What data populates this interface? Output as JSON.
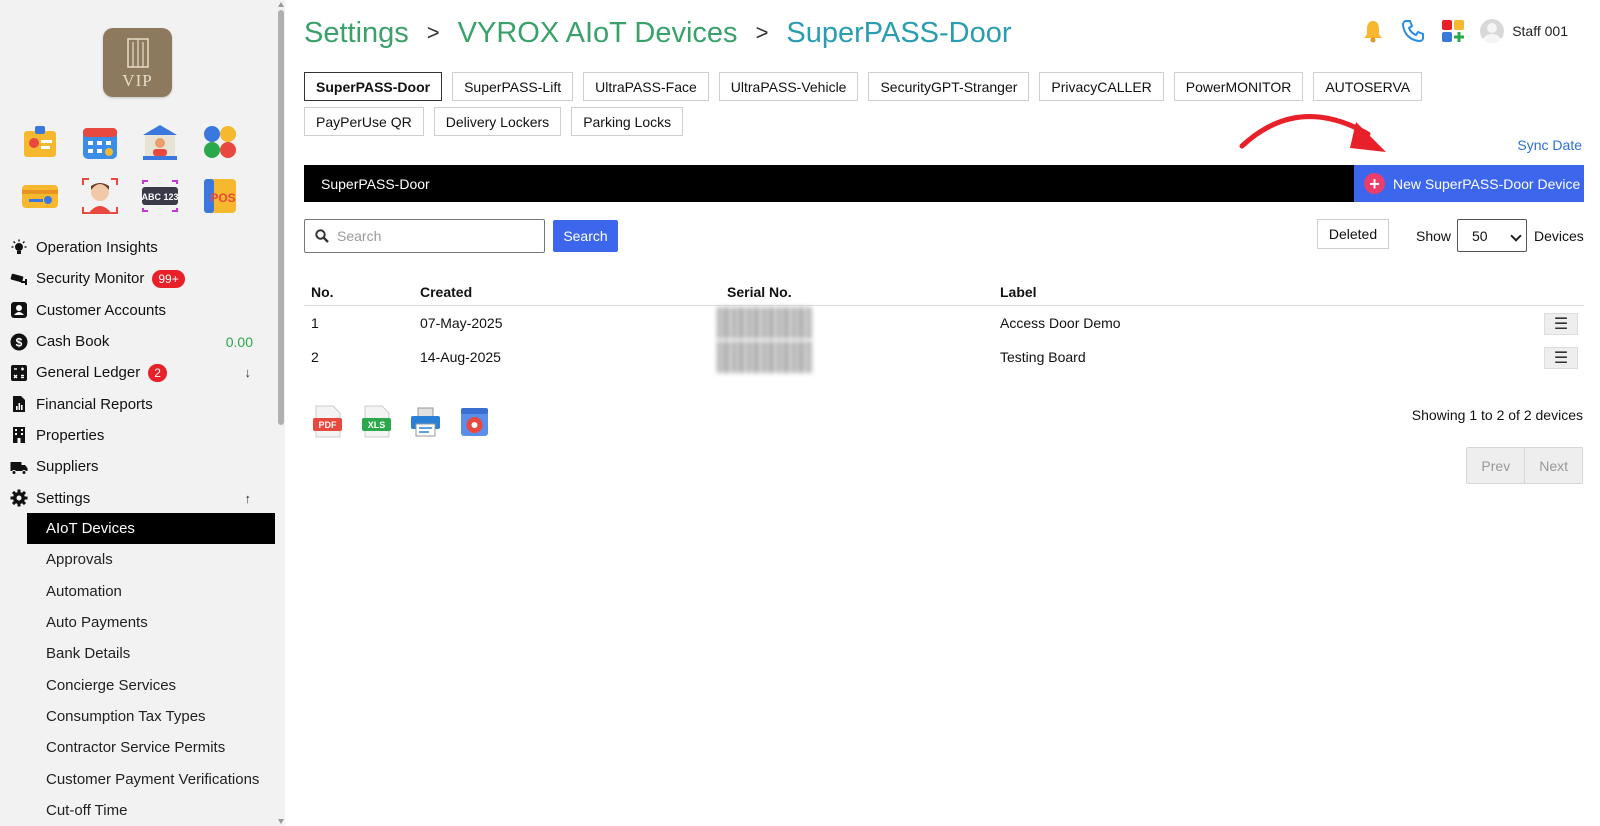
{
  "breadcrumb": {
    "root": "Settings",
    "section": "VYROX AIoT Devices",
    "current": "SuperPASS-Door"
  },
  "user": {
    "name": "Staff 001"
  },
  "logo": {
    "text": "VIP"
  },
  "sidebar": {
    "nav": [
      {
        "label": "Operation Insights",
        "icon": "lightbulb-icon"
      },
      {
        "label": "Security Monitor",
        "icon": "cctv-icon",
        "badge": "99+"
      },
      {
        "label": "Customer Accounts",
        "icon": "contact-card-icon"
      },
      {
        "label": "Cash Book",
        "icon": "dollar-icon",
        "value": "0.00"
      },
      {
        "label": "General Ledger",
        "icon": "calculator-icon",
        "badge": "2",
        "arrow": "↓"
      },
      {
        "label": "Financial Reports",
        "icon": "report-icon"
      },
      {
        "label": "Properties",
        "icon": "building-icon"
      },
      {
        "label": "Suppliers",
        "icon": "truck-icon"
      },
      {
        "label": "Settings",
        "icon": "gear-icon",
        "arrow": "↑"
      }
    ],
    "sub": [
      "AIoT Devices",
      "Approvals",
      "Automation",
      "Auto Payments",
      "Bank Details",
      "Concierge Services",
      "Consumption Tax Types",
      "Contractor Service Permits",
      "Customer Payment Verifications",
      "Cut-off Time"
    ]
  },
  "tabs": [
    "SuperPASS-Door",
    "SuperPASS-Lift",
    "UltraPASS-Face",
    "UltraPASS-Vehicle",
    "SecurityGPT-Stranger",
    "PrivacyCALLER",
    "PowerMONITOR",
    "AUTOSERVA",
    "PayPerUse QR",
    "Delivery Lockers",
    "Parking Locks"
  ],
  "sync_date": "Sync Date",
  "banner": {
    "title": "SuperPASS-Door",
    "new_button": "New SuperPASS-Door Device"
  },
  "search": {
    "placeholder": "Search",
    "button": "Search"
  },
  "controls": {
    "deleted": "Deleted",
    "show": "Show",
    "page_size": "50",
    "devices": "Devices"
  },
  "table": {
    "headers": [
      "No.",
      "Created",
      "Serial No.",
      "Label"
    ],
    "rows": [
      {
        "no": "1",
        "created": "07-May-2025",
        "label": "Access Door Demo"
      },
      {
        "no": "2",
        "created": "14-Aug-2025",
        "label": "Testing Board"
      }
    ]
  },
  "exports": [
    "PDF",
    "XLS"
  ],
  "showing": "Showing 1 to 2 of 2 devices",
  "pager": {
    "prev": "Prev",
    "next": "Next"
  }
}
